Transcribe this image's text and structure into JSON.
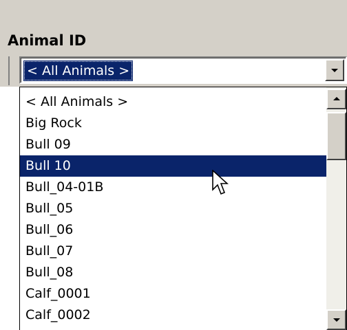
{
  "field": {
    "label": "Animal ID",
    "selected_value": "< All Animals >"
  },
  "dropdown": {
    "items": [
      "< All Animals >",
      "Big Rock",
      "Bull 09",
      "Bull 10",
      "Bull_04-01B",
      "Bull_05",
      "Bull_06",
      "Bull_07",
      "Bull_08",
      "Calf_0001",
      "Calf_0002"
    ],
    "highlighted": "Bull 10"
  },
  "colors": {
    "selection": "#0a246a",
    "panel": "#d4d0c8"
  },
  "icons": {
    "combo_button": "chevron-down-icon",
    "scroll_up": "scroll-up-arrow-icon",
    "scroll_down": "scroll-down-arrow-icon",
    "cursor": "mouse-pointer-icon"
  }
}
